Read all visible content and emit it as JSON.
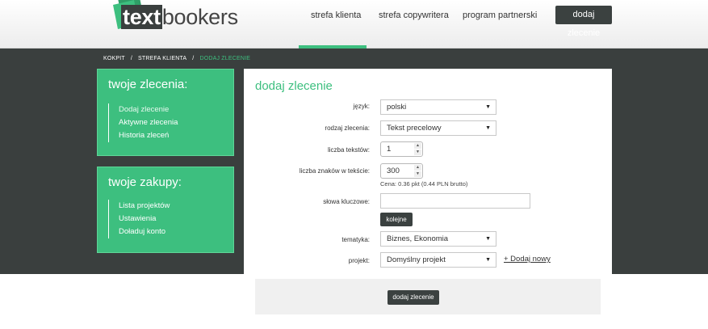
{
  "header": {
    "logo": {
      "text_part1": "text",
      "text_part2": "bookers"
    },
    "nav": [
      {
        "label": "strefa klienta"
      },
      {
        "label": "strefa copywritera"
      },
      {
        "label": "program partnerski"
      }
    ],
    "cta_label": "dodaj zlecenie"
  },
  "breadcrumb": {
    "items": [
      "KOKPIT",
      "STREFA KLIENTA",
      "DODAJ ZLECENIE"
    ],
    "separator": "/"
  },
  "sidebar": {
    "orders": {
      "title": "twoje zlecenia:",
      "items": [
        {
          "label": "Dodaj zlecenie"
        },
        {
          "label": "Aktywne zlecenia"
        },
        {
          "label": "Historia zleceń"
        }
      ]
    },
    "purchases": {
      "title": "twoje zakupy:",
      "items": [
        {
          "label": "Lista projektów"
        },
        {
          "label": "Ustawienia"
        },
        {
          "label": "Doładuj konto"
        }
      ]
    }
  },
  "form": {
    "title": "dodaj zlecenie",
    "language": {
      "label": "język:",
      "value": "polski"
    },
    "order_type": {
      "label": "rodzaj zlecenia:",
      "value": "Tekst precelowy"
    },
    "text_count": {
      "label": "liczba tekstów:",
      "value": "1"
    },
    "char_count": {
      "label": "liczba znaków w tekście:",
      "value": "300"
    },
    "price_note": "Cena: 0.36 pkt (0.44 PLN brutto)",
    "keywords": {
      "label": "słowa kluczowe:",
      "value": ""
    },
    "next_button": "kolejne",
    "topic": {
      "label": "tematyka:",
      "value": "Biznes, Ekonomia"
    },
    "project": {
      "label": "projekt:",
      "value": "Domyślny projekt"
    },
    "add_new_link": "+ Dodaj nowy",
    "submit_label": "dodaj zlecenie"
  },
  "colors": {
    "accent": "#3dbf7f",
    "dark": "#3a3f3e",
    "button_dark": "#3b4140"
  }
}
